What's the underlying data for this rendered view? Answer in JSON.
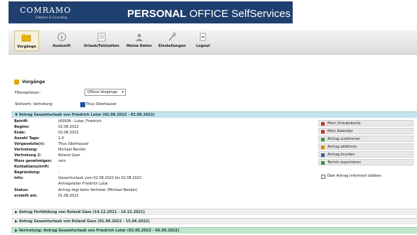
{
  "header": {
    "logo": "COMRAMO",
    "logo_sub": "Software & Consulting",
    "app_title_bold": "PERSONAL",
    "app_title_rest": " OFFICE SelfServices"
  },
  "toolbar": {
    "items": [
      {
        "label": "Vorgänge",
        "icon": "folder-icon"
      },
      {
        "label": "Auskunft",
        "icon": "info-icon"
      },
      {
        "label": "Urlaub/Fehlzeiten",
        "icon": "calendar-icon"
      },
      {
        "label": "Meine Daten",
        "icon": "user-icon"
      },
      {
        "label": "Einstellungen",
        "icon": "wrench-icon"
      },
      {
        "label": "Logout",
        "icon": "logout-icon"
      }
    ]
  },
  "section": {
    "title": "Vorgänge"
  },
  "filter": {
    "label": "Filteroptionen:",
    "value": "Offene Vorgänge"
  },
  "delegation": {
    "label": "Stellvertr. Vertretung:",
    "value": "Titus Oberhauser"
  },
  "open_request": {
    "title": "▼ Antrag Gesamturlaub von Friedrich Lutar (02.08.2022 - 02.08.2022)",
    "rows": [
      {
        "label": "Betriff:",
        "value": "(K0006 - Lutar, Friedrich"
      },
      {
        "label": "Beginn:",
        "value": "02.08.2022"
      },
      {
        "label": "Ende:",
        "value": "02.08.2022"
      },
      {
        "label": "Anzahl Tage:",
        "value": "1.0"
      },
      {
        "label": "Vorgesetzte(r):",
        "value": "Titus Oberhauser"
      },
      {
        "label": "Vertretung:",
        "value": "Michael Bender"
      },
      {
        "label": "Vertretung 2:",
        "value": "Roland Gass"
      },
      {
        "label": "Muss genehmigen:",
        "value": "nein"
      },
      {
        "label": "Kontaktanschrift:",
        "value": "-"
      },
      {
        "label": "Begründung:",
        "value": "-"
      },
      {
        "label": "Info:",
        "value": "Gesamturlaub vom 02.08.2022 bis 02.08.2022"
      },
      {
        "label": "",
        "value": "Antragsteller Friedrich Lutar"
      },
      {
        "label": "Status:",
        "value": "Antrag liegt beim Vertreter (Michael Bender)"
      },
      {
        "label": "erstellt am:",
        "value": "01.08.2022"
      }
    ],
    "actions": [
      {
        "label": "Mein Urlaubskonto",
        "icon": "account-icon",
        "color": "#c0392b"
      },
      {
        "label": "Mein Kalender",
        "icon": "calendar-icon",
        "color": "#c0392b"
      },
      {
        "label": "Antrag zustimmen",
        "icon": "approve-icon",
        "color": "#3a9a3a"
      },
      {
        "label": "Antrag ablehnen",
        "icon": "reject-icon",
        "color": "#d08a00"
      },
      {
        "label": "Antrag drucken",
        "icon": "print-icon",
        "color": "#3a5fa0"
      },
      {
        "label": "Termin exportieren",
        "icon": "export-icon",
        "color": "#3a8f3a"
      }
    ],
    "inform_label": "Über Antrag informiert bleiben"
  },
  "other_requests": [
    {
      "title": "▶ Antrag Fortbildung von Roland Gass (14.12.2021 - 14.12.2021)"
    },
    {
      "title": "▶ Antrag Gesamturlaub von Roland Gass (01.06.2022 - 15.06.2022)"
    },
    {
      "title": "▶ Vertretung: Antrag Gesamturlaub von Friedrich Lutar (02.05.2022 - 05.05.2022)"
    }
  ],
  "colors": {
    "brand": "#1f3f6e",
    "open_header": "#c7e3ec",
    "delegation_header": "#bfe6cc"
  }
}
